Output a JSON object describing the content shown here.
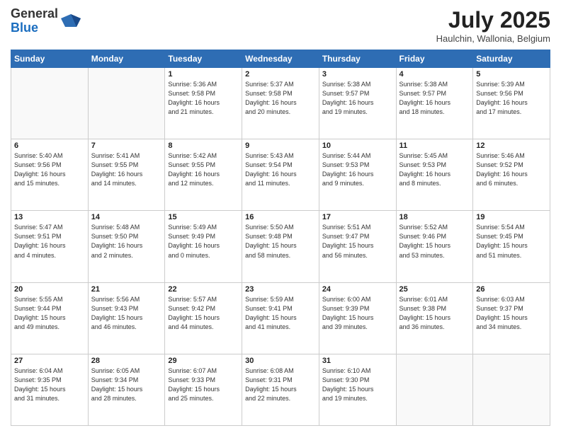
{
  "logo": {
    "general": "General",
    "blue": "Blue"
  },
  "title": "July 2025",
  "location": "Haulchin, Wallonia, Belgium",
  "days_of_week": [
    "Sunday",
    "Monday",
    "Tuesday",
    "Wednesday",
    "Thursday",
    "Friday",
    "Saturday"
  ],
  "weeks": [
    [
      {
        "day": "",
        "info": ""
      },
      {
        "day": "",
        "info": ""
      },
      {
        "day": "1",
        "info": "Sunrise: 5:36 AM\nSunset: 9:58 PM\nDaylight: 16 hours\nand 21 minutes."
      },
      {
        "day": "2",
        "info": "Sunrise: 5:37 AM\nSunset: 9:58 PM\nDaylight: 16 hours\nand 20 minutes."
      },
      {
        "day": "3",
        "info": "Sunrise: 5:38 AM\nSunset: 9:57 PM\nDaylight: 16 hours\nand 19 minutes."
      },
      {
        "day": "4",
        "info": "Sunrise: 5:38 AM\nSunset: 9:57 PM\nDaylight: 16 hours\nand 18 minutes."
      },
      {
        "day": "5",
        "info": "Sunrise: 5:39 AM\nSunset: 9:56 PM\nDaylight: 16 hours\nand 17 minutes."
      }
    ],
    [
      {
        "day": "6",
        "info": "Sunrise: 5:40 AM\nSunset: 9:56 PM\nDaylight: 16 hours\nand 15 minutes."
      },
      {
        "day": "7",
        "info": "Sunrise: 5:41 AM\nSunset: 9:55 PM\nDaylight: 16 hours\nand 14 minutes."
      },
      {
        "day": "8",
        "info": "Sunrise: 5:42 AM\nSunset: 9:55 PM\nDaylight: 16 hours\nand 12 minutes."
      },
      {
        "day": "9",
        "info": "Sunrise: 5:43 AM\nSunset: 9:54 PM\nDaylight: 16 hours\nand 11 minutes."
      },
      {
        "day": "10",
        "info": "Sunrise: 5:44 AM\nSunset: 9:53 PM\nDaylight: 16 hours\nand 9 minutes."
      },
      {
        "day": "11",
        "info": "Sunrise: 5:45 AM\nSunset: 9:53 PM\nDaylight: 16 hours\nand 8 minutes."
      },
      {
        "day": "12",
        "info": "Sunrise: 5:46 AM\nSunset: 9:52 PM\nDaylight: 16 hours\nand 6 minutes."
      }
    ],
    [
      {
        "day": "13",
        "info": "Sunrise: 5:47 AM\nSunset: 9:51 PM\nDaylight: 16 hours\nand 4 minutes."
      },
      {
        "day": "14",
        "info": "Sunrise: 5:48 AM\nSunset: 9:50 PM\nDaylight: 16 hours\nand 2 minutes."
      },
      {
        "day": "15",
        "info": "Sunrise: 5:49 AM\nSunset: 9:49 PM\nDaylight: 16 hours\nand 0 minutes."
      },
      {
        "day": "16",
        "info": "Sunrise: 5:50 AM\nSunset: 9:48 PM\nDaylight: 15 hours\nand 58 minutes."
      },
      {
        "day": "17",
        "info": "Sunrise: 5:51 AM\nSunset: 9:47 PM\nDaylight: 15 hours\nand 56 minutes."
      },
      {
        "day": "18",
        "info": "Sunrise: 5:52 AM\nSunset: 9:46 PM\nDaylight: 15 hours\nand 53 minutes."
      },
      {
        "day": "19",
        "info": "Sunrise: 5:54 AM\nSunset: 9:45 PM\nDaylight: 15 hours\nand 51 minutes."
      }
    ],
    [
      {
        "day": "20",
        "info": "Sunrise: 5:55 AM\nSunset: 9:44 PM\nDaylight: 15 hours\nand 49 minutes."
      },
      {
        "day": "21",
        "info": "Sunrise: 5:56 AM\nSunset: 9:43 PM\nDaylight: 15 hours\nand 46 minutes."
      },
      {
        "day": "22",
        "info": "Sunrise: 5:57 AM\nSunset: 9:42 PM\nDaylight: 15 hours\nand 44 minutes."
      },
      {
        "day": "23",
        "info": "Sunrise: 5:59 AM\nSunset: 9:41 PM\nDaylight: 15 hours\nand 41 minutes."
      },
      {
        "day": "24",
        "info": "Sunrise: 6:00 AM\nSunset: 9:39 PM\nDaylight: 15 hours\nand 39 minutes."
      },
      {
        "day": "25",
        "info": "Sunrise: 6:01 AM\nSunset: 9:38 PM\nDaylight: 15 hours\nand 36 minutes."
      },
      {
        "day": "26",
        "info": "Sunrise: 6:03 AM\nSunset: 9:37 PM\nDaylight: 15 hours\nand 34 minutes."
      }
    ],
    [
      {
        "day": "27",
        "info": "Sunrise: 6:04 AM\nSunset: 9:35 PM\nDaylight: 15 hours\nand 31 minutes."
      },
      {
        "day": "28",
        "info": "Sunrise: 6:05 AM\nSunset: 9:34 PM\nDaylight: 15 hours\nand 28 minutes."
      },
      {
        "day": "29",
        "info": "Sunrise: 6:07 AM\nSunset: 9:33 PM\nDaylight: 15 hours\nand 25 minutes."
      },
      {
        "day": "30",
        "info": "Sunrise: 6:08 AM\nSunset: 9:31 PM\nDaylight: 15 hours\nand 22 minutes."
      },
      {
        "day": "31",
        "info": "Sunrise: 6:10 AM\nSunset: 9:30 PM\nDaylight: 15 hours\nand 19 minutes."
      },
      {
        "day": "",
        "info": ""
      },
      {
        "day": "",
        "info": ""
      }
    ]
  ]
}
